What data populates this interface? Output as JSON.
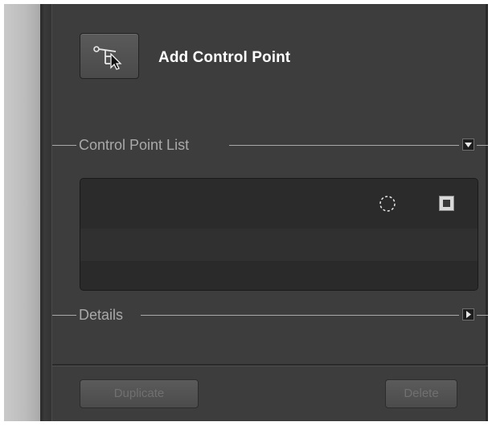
{
  "tool": {
    "icon": "add-control-point-icon",
    "label": "Add Control Point"
  },
  "sections": {
    "control_point_list": {
      "title": "Control Point List",
      "toggle_icon": "triangle-down-icon",
      "expanded": true
    },
    "details": {
      "title": "Details",
      "toggle_icon": "triangle-right-icon",
      "expanded": false
    }
  },
  "list": {
    "rows": [
      {
        "visibility_icon": "dashed-circle-icon",
        "checkbox_icon": "checkbox-square-icon"
      },
      {},
      {}
    ]
  },
  "buttons": {
    "duplicate": "Duplicate",
    "delete": "Delete"
  },
  "colors": {
    "panel_bg": "#3d3d3d",
    "text_white": "#ffffff",
    "section_text": "#a9a9a9"
  }
}
